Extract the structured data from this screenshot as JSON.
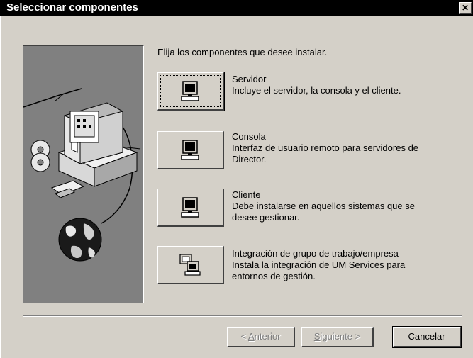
{
  "window": {
    "title": "Seleccionar componentes",
    "close_glyph": "✕"
  },
  "instruction": "Elija los componentes que desee instalar.",
  "components": [
    {
      "icon": "computer-icon",
      "name": "Servidor",
      "description": "Incluye el servidor, la consola y el cliente."
    },
    {
      "icon": "computer-icon",
      "name": "Consola",
      "description_line1": "Interfaz de usuario remoto para servidores de",
      "description_line2": "Director."
    },
    {
      "icon": "computer-icon",
      "name": "Cliente",
      "description_line1": "Debe instalarse en aquellos sistemas que se",
      "description_line2": "desee gestionar."
    },
    {
      "icon": "workgroup-computers-icon",
      "name": "Integración de grupo de trabajo/empresa",
      "description_line1": "Instala la integración de UM Services para",
      "description_line2": "entornos de gestión."
    }
  ],
  "buttons": {
    "back": {
      "prefix": "< ",
      "mnemonic": "A",
      "rest": "nterior"
    },
    "next": {
      "mnemonic": "S",
      "rest": "iguiente",
      "suffix": " >"
    },
    "cancel": "Cancelar"
  },
  "colors": {
    "titlebar": "#000000",
    "dialog": "#d4d0c8",
    "illustration": "#808080"
  }
}
